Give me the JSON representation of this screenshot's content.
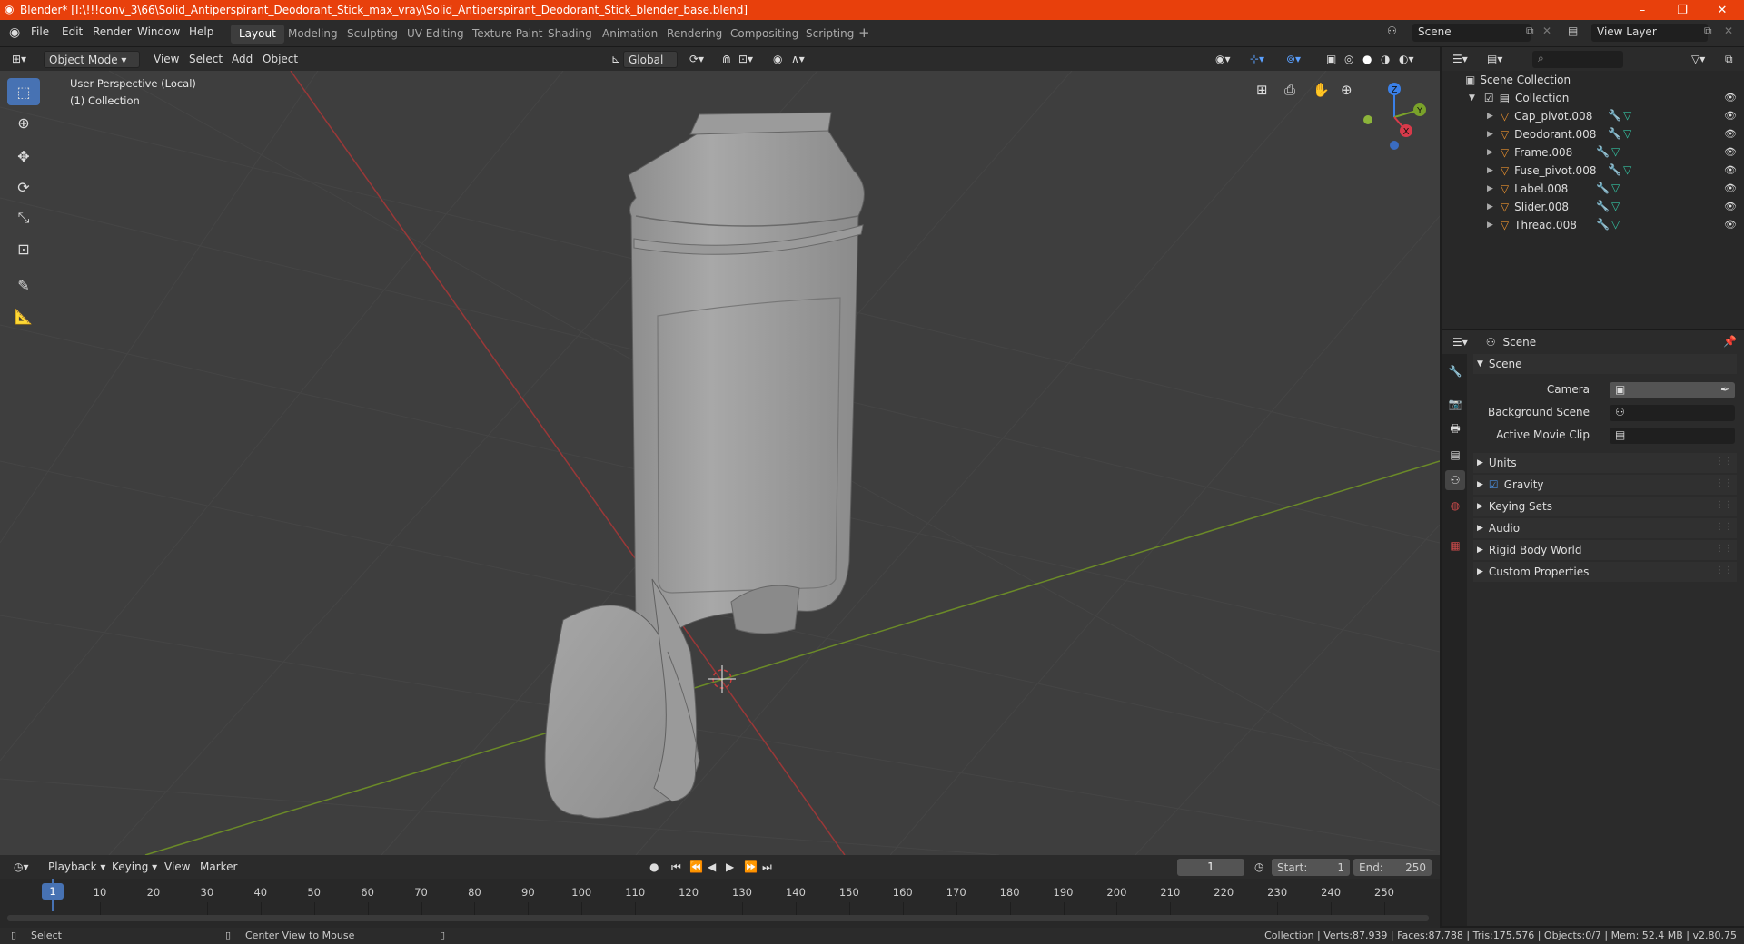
{
  "window": {
    "title": "Blender* [I:\\!!!conv_3\\66\\Solid_Antiperspirant_Deodorant_Stick_max_vray\\Solid_Antiperspirant_Deodorant_Stick_blender_base.blend]"
  },
  "menu": [
    "File",
    "Edit",
    "Render",
    "Window",
    "Help"
  ],
  "workspaces": [
    "Layout",
    "Modeling",
    "Sculpting",
    "UV Editing",
    "Texture Paint",
    "Shading",
    "Animation",
    "Rendering",
    "Compositing",
    "Scripting"
  ],
  "active_workspace": "Layout",
  "scene_selector": "Scene",
  "view_layer_selector": "View Layer",
  "viewport_header": {
    "mode": "Object Mode",
    "menus": [
      "View",
      "Select",
      "Add",
      "Object"
    ],
    "transform_orientation": "Global"
  },
  "viewport": {
    "perspective_label": "User Perspective (Local)",
    "collection_label": "(1) Collection"
  },
  "gizmo": {
    "x": "X",
    "y": "Y",
    "z": "Z"
  },
  "outliner": {
    "root": "Scene Collection",
    "collection": "Collection",
    "objects": [
      "Cap_pivot.008",
      "Deodorant.008",
      "Frame.008",
      "Fuse_pivot.008",
      "Label.008",
      "Slider.008",
      "Thread.008"
    ]
  },
  "properties": {
    "header": "Scene",
    "panel": "Scene",
    "fields": [
      {
        "label": "Camera"
      },
      {
        "label": "Background Scene"
      },
      {
        "label": "Active Movie Clip"
      }
    ],
    "subpanels": [
      {
        "label": "Units",
        "checkbox": false
      },
      {
        "label": "Gravity",
        "checkbox": true
      },
      {
        "label": "Keying Sets",
        "checkbox": false
      },
      {
        "label": "Audio",
        "checkbox": false
      },
      {
        "label": "Rigid Body World",
        "checkbox": false
      },
      {
        "label": "Custom Properties",
        "checkbox": false
      }
    ]
  },
  "timeline": {
    "menus": [
      "Playback",
      "Keying",
      "View",
      "Marker"
    ],
    "current_frame": "1",
    "start_label": "Start:",
    "start": "1",
    "end_label": "End:",
    "end": "250",
    "ticks": [
      "1",
      "10",
      "20",
      "30",
      "40",
      "50",
      "60",
      "70",
      "80",
      "90",
      "100",
      "110",
      "120",
      "130",
      "140",
      "150",
      "160",
      "170",
      "180",
      "190",
      "200",
      "210",
      "220",
      "230",
      "240",
      "250"
    ]
  },
  "statusbar": {
    "select": "Select",
    "center_view": "Center View to Mouse",
    "stats": "Collection | Verts:87,939 | Faces:87,788 | Tris:175,576 | Objects:0/7 | Mem: 52.4 MB | v2.80.75"
  }
}
